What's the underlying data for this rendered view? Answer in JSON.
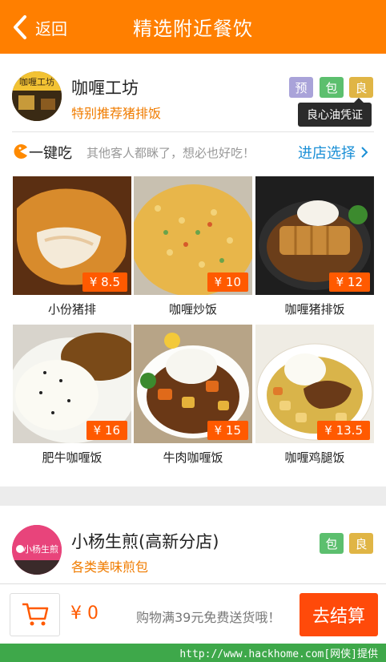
{
  "header": {
    "back_label": "返回",
    "title": "精选附近餐饮"
  },
  "shop1": {
    "name": "咖喱工坊",
    "subtitle": "特别推荐猪排饭",
    "logo_text": "咖喱工坊",
    "tags": [
      {
        "label": "预",
        "color": "#a9a3d9"
      },
      {
        "label": "包",
        "color": "#5cbf6e"
      },
      {
        "label": "良",
        "color": "#e0b545"
      }
    ],
    "tooltip": "良心油凭证",
    "quick": {
      "label": "一键吃",
      "hint": "其他客人都眯了，想必也好吃！",
      "link": "进店选择"
    },
    "foods": [
      {
        "name": "小份猪排",
        "price": "¥ 8.5"
      },
      {
        "name": "咖喱炒饭",
        "price": "¥ 10"
      },
      {
        "name": "咖喱猪排饭",
        "price": "¥ 12"
      },
      {
        "name": "肥牛咖喱饭",
        "price": "¥ 16"
      },
      {
        "name": "牛肉咖喱饭",
        "price": "¥ 15"
      },
      {
        "name": "咖喱鸡腿饭",
        "price": "¥ 13.5"
      }
    ]
  },
  "shop2": {
    "name": "小杨生煎(高新分店)",
    "subtitle": "各类美味煎包",
    "logo_text": "小杨生煎",
    "tags": [
      {
        "label": "包",
        "color": "#5cbf6e"
      },
      {
        "label": "良",
        "color": "#e0b545"
      }
    ]
  },
  "footer": {
    "total": "¥ 0",
    "promo": "购物满39元免费送货哦！",
    "checkout": "去结算"
  },
  "watermark": "http://www.hackhome.com[网侠]提供",
  "colors": {
    "accent": "#ff7f00",
    "price": "#ff5a00",
    "link": "#1a8fd6"
  }
}
